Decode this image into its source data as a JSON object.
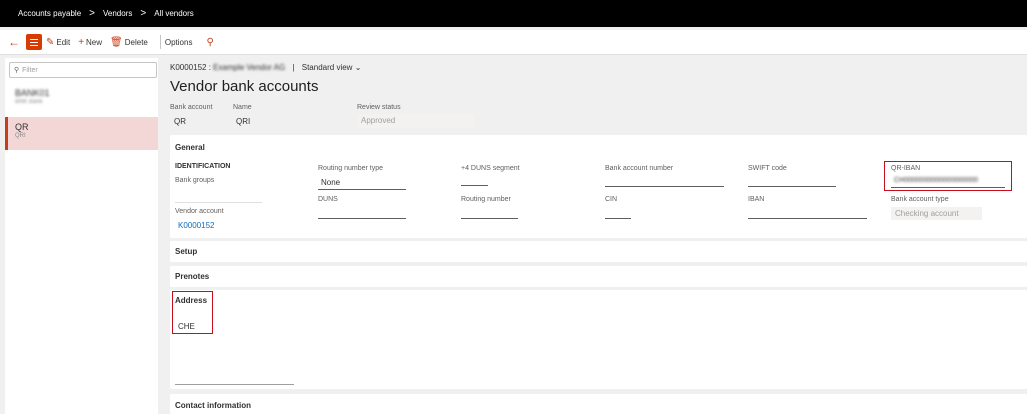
{
  "breadcrumb": {
    "items": [
      "Accounts payable",
      "Vendors",
      "All vendors"
    ],
    "separator": ">"
  },
  "toolbar": {
    "edit_label": "Edit",
    "new_label": "New",
    "delete_label": "Delete",
    "options_label": "Options"
  },
  "list": {
    "filter_placeholder": "Filter",
    "items": [
      {
        "title": "BANK01",
        "subtitle": "BNK Bank"
      },
      {
        "title": "QR",
        "subtitle": "QRI"
      }
    ]
  },
  "record": {
    "vendor_id": "K0000152",
    "vendor_name": "Example Vendor AG",
    "separator": "|",
    "view": "Standard view",
    "page_title": "Vendor bank accounts",
    "bank_account_label": "Bank account",
    "bank_account_value": "QR",
    "name_label": "Name",
    "name_value": "QRI",
    "review_status_label": "Review status",
    "review_status_value": "Approved"
  },
  "general": {
    "title": "General",
    "identification_heading": "IDENTIFICATION",
    "bank_groups_label": "Bank groups",
    "vendor_account_label": "Vendor account",
    "vendor_account_value": "K0000152",
    "routing_number_type_label": "Routing number type",
    "routing_number_type_value": "None",
    "duns_label": "DUNS",
    "duns4_label": "+4 DUNS segment",
    "routing_number_label": "Routing number",
    "bank_account_number_label": "Bank account number",
    "cin_label": "CIN",
    "swift_label": "SWIFT code",
    "iban_label": "IBAN",
    "qr_iban_label": "QR-IBAN",
    "qr_iban_value": "CH0000000000000000000",
    "bank_account_type_label": "Bank account type",
    "bank_account_type_value": "Checking account"
  },
  "sections": {
    "setup": "Setup",
    "prenotes": "Prenotes",
    "address_title": "Address",
    "address_value": "CHE",
    "contact": "Contact information"
  },
  "colors": {
    "accent": "#c43e1c",
    "highlight": "#c50f1f",
    "link": "#0f6cbd",
    "selected_bg": "#f3d7d7"
  }
}
